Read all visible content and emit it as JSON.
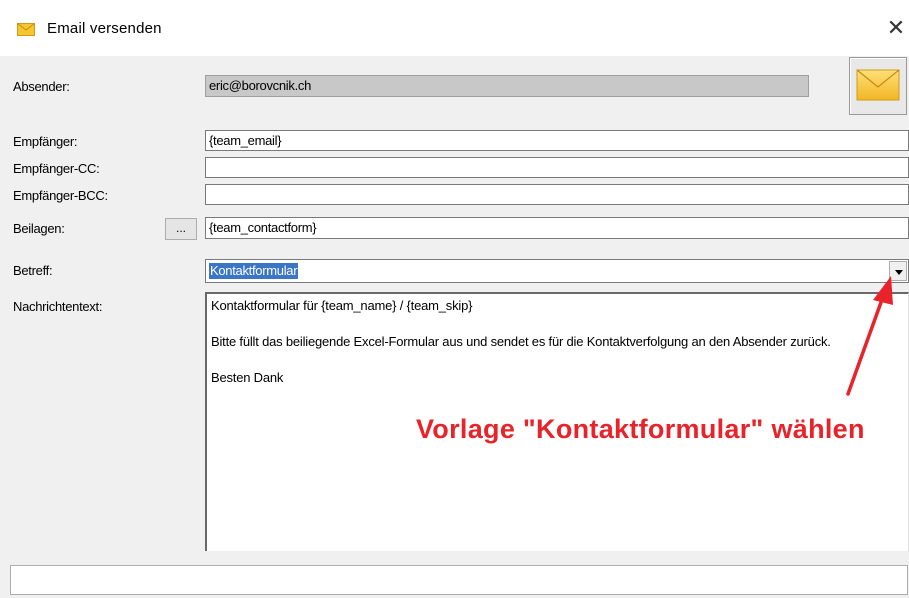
{
  "window": {
    "title": "Email versenden",
    "close_glyph": "✕",
    "icon": "envelope-icon"
  },
  "labels": {
    "sender": "Absender:",
    "to": "Empfänger:",
    "cc": "Empfänger-CC:",
    "bcc": "Empfänger-BCC:",
    "attachments": "Beilagen:",
    "subject": "Betreff:",
    "body": "Nachrichtentext:"
  },
  "fields": {
    "sender": "eric@borovcnik.ch",
    "to": "{team_email}",
    "cc": "",
    "bcc": "",
    "attachments": "{team_contactform}",
    "attachments_button": "...",
    "subject": "Kontaktformular"
  },
  "body_lines": [
    "Kontaktformular für {team_name} / {team_skip}",
    "",
    "Bitte füllt das beiliegende Excel-Formular aus und sendet es für die Kontaktverfolgung an den Absender zurück.",
    "",
    "Besten Dank"
  ],
  "annotation": {
    "text": "Vorlage \"Kontaktformular\" wählen",
    "color": "#e8232a"
  },
  "status_text": "",
  "colors": {
    "selection": "#3b75c7",
    "readonly_bg": "#c8c8c8",
    "envelope": "#f6c630"
  }
}
